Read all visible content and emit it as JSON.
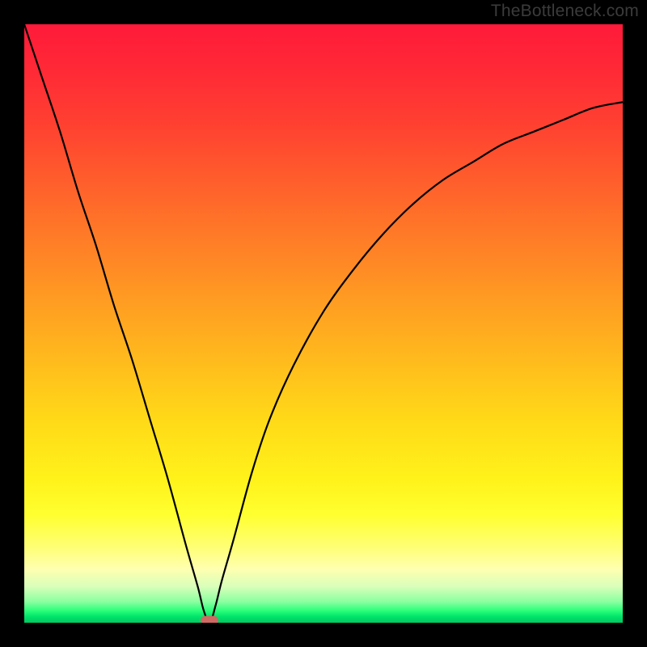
{
  "attribution": "TheBottleneck.com",
  "colors": {
    "curve": "#000000",
    "marker": "#cf6a63",
    "frame": "#000000"
  },
  "chart_data": {
    "type": "line",
    "title": "",
    "xlabel": "",
    "ylabel": "",
    "xlim": [
      0,
      1
    ],
    "ylim": [
      0,
      1
    ],
    "grid": false,
    "legend": false,
    "x_min_at": 0.31,
    "marker": {
      "x": 0.31,
      "y": 0.0
    },
    "x": [
      0.0,
      0.03,
      0.06,
      0.09,
      0.12,
      0.15,
      0.18,
      0.21,
      0.24,
      0.27,
      0.29,
      0.3,
      0.31,
      0.32,
      0.33,
      0.35,
      0.38,
      0.41,
      0.45,
      0.5,
      0.55,
      0.6,
      0.65,
      0.7,
      0.75,
      0.8,
      0.85,
      0.9,
      0.95,
      1.0
    ],
    "y": [
      1.0,
      0.91,
      0.82,
      0.72,
      0.63,
      0.53,
      0.44,
      0.34,
      0.24,
      0.13,
      0.06,
      0.02,
      0.0,
      0.03,
      0.07,
      0.14,
      0.25,
      0.34,
      0.43,
      0.52,
      0.59,
      0.65,
      0.7,
      0.74,
      0.77,
      0.8,
      0.82,
      0.84,
      0.86,
      0.87
    ]
  }
}
